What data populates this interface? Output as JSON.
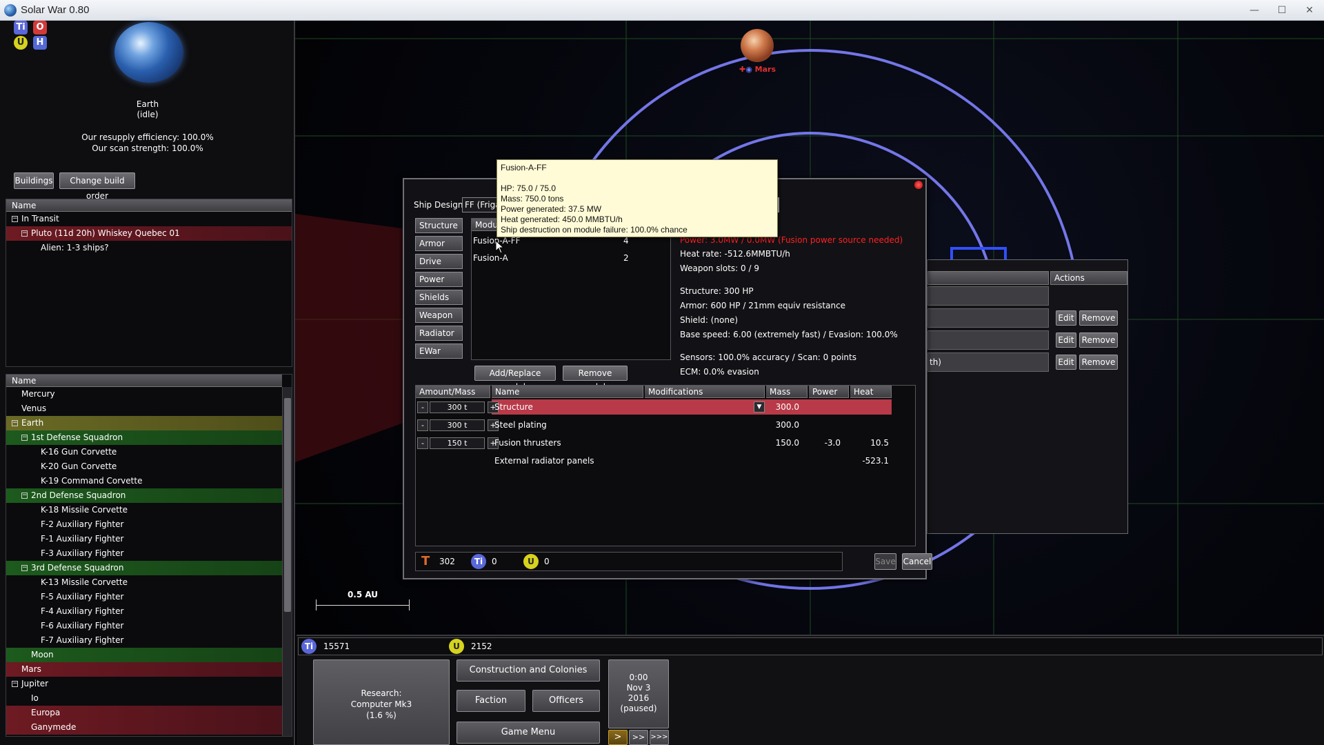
{
  "window": {
    "title": "Solar War 0.80",
    "minimize": "—",
    "maximize": "☐",
    "close": "✕"
  },
  "left": {
    "res_icons": [
      {
        "label": "Ti",
        "color": "#5a67d8"
      },
      {
        "label": "O",
        "color": "#d23a3a"
      },
      {
        "label": "U",
        "color": "#d6d21f"
      },
      {
        "label": "H",
        "color": "#5468d6"
      }
    ],
    "planet_name": "Earth",
    "planet_status": "(idle)",
    "resupply": "Our resupply efficiency: 100.0%",
    "scan": "Our scan strength: 100.0%",
    "buttons": {
      "buildings": "Buildings",
      "build_order": "Change build order"
    },
    "transit": {
      "header": "Name",
      "rows": [
        {
          "label": "In Transit",
          "level": 0,
          "toggle": "−",
          "style": ""
        },
        {
          "label": "Pluto (11d 20h) Whiskey Quebec 01",
          "level": 1,
          "toggle": "−",
          "style": "red"
        },
        {
          "label": "Alien: 1-3 ships?",
          "level": 2,
          "toggle": "",
          "style": ""
        }
      ]
    },
    "systems": {
      "header": "Name",
      "rows": [
        {
          "label": "Mercury",
          "level": 0,
          "toggle": "",
          "style": ""
        },
        {
          "label": "Venus",
          "level": 0,
          "toggle": "",
          "style": ""
        },
        {
          "label": "Earth",
          "level": 0,
          "toggle": "−",
          "style": "olive"
        },
        {
          "label": "1st Defense Squadron",
          "level": 1,
          "toggle": "−",
          "style": "green"
        },
        {
          "label": "K-16 Gun Corvette",
          "level": 2,
          "toggle": "",
          "style": ""
        },
        {
          "label": "K-20 Gun Corvette",
          "level": 2,
          "toggle": "",
          "style": ""
        },
        {
          "label": "K-19 Command Corvette",
          "level": 2,
          "toggle": "",
          "style": ""
        },
        {
          "label": "2nd Defense Squadron",
          "level": 1,
          "toggle": "−",
          "style": "green"
        },
        {
          "label": "K-18 Missile Corvette",
          "level": 2,
          "toggle": "",
          "style": ""
        },
        {
          "label": "F-2 Auxiliary Fighter",
          "level": 2,
          "toggle": "",
          "style": ""
        },
        {
          "label": "F-1 Auxiliary Fighter",
          "level": 2,
          "toggle": "",
          "style": ""
        },
        {
          "label": "F-3 Auxiliary Fighter",
          "level": 2,
          "toggle": "",
          "style": ""
        },
        {
          "label": "3rd Defense Squadron",
          "level": 1,
          "toggle": "−",
          "style": "green"
        },
        {
          "label": "K-13 Missile Corvette",
          "level": 2,
          "toggle": "",
          "style": ""
        },
        {
          "label": "F-5 Auxiliary Fighter",
          "level": 2,
          "toggle": "",
          "style": ""
        },
        {
          "label": "F-4 Auxiliary Fighter",
          "level": 2,
          "toggle": "",
          "style": ""
        },
        {
          "label": "F-6 Auxiliary Fighter",
          "level": 2,
          "toggle": "",
          "style": ""
        },
        {
          "label": "F-7 Auxiliary Fighter",
          "level": 2,
          "toggle": "",
          "style": ""
        },
        {
          "label": "Moon",
          "level": 1,
          "toggle": "",
          "style": "green"
        },
        {
          "label": "Mars",
          "level": 0,
          "toggle": "",
          "style": "red"
        },
        {
          "label": "Jupiter",
          "level": 0,
          "toggle": "−",
          "style": ""
        },
        {
          "label": "Io",
          "level": 1,
          "toggle": "",
          "style": ""
        },
        {
          "label": "Europa",
          "level": 1,
          "toggle": "",
          "style": "red"
        },
        {
          "label": "Ganymede",
          "level": 1,
          "toggle": "",
          "style": "red"
        }
      ]
    }
  },
  "map": {
    "mars_label": "Mars",
    "scale_label": "0.5 AU"
  },
  "fleet_panel": {
    "actions_header": "Actions",
    "partial_text": "th)",
    "rows": [
      {
        "edit": "Edit",
        "remove": "Remove"
      },
      {
        "edit": "Edit",
        "remove": "Remove"
      },
      {
        "edit": "Edit",
        "remove": "Remove"
      }
    ]
  },
  "dialog": {
    "ship_design_label": "Ship Design",
    "design_value": "FF (Friga",
    "categories": [
      "Structure",
      "Armor",
      "Drive",
      "Power",
      "Shields",
      "Weapon",
      "Radiator",
      "EWar"
    ],
    "module_header": "Modu",
    "modules": [
      {
        "name": "Fusion-A-FF",
        "count": "4"
      },
      {
        "name": "Fusion-A",
        "count": "2"
      }
    ],
    "power_warning": "Power: 3.0MW / 0.0MW (Fusion power source needed)",
    "stats1": [
      "Heat rate: -512.6MMBTU/h",
      "Weapon slots: 0 / 9"
    ],
    "stats2": [
      "Structure: 300 HP",
      "Armor: 600 HP / 21mm equiv resistance",
      "Shield: (none)",
      "Base speed: 6.00 (extremely fast) / Evasion: 100.0%"
    ],
    "stats3": [
      "Sensors: 100.0% accuracy / Scan: 0 points",
      "ECM: 0.0% evasion"
    ],
    "add_replace": "Add/Replace module",
    "remove_module": "Remove module",
    "columns": [
      "Amount/Mass",
      "Name",
      "Modifications",
      "Mass",
      "Power",
      "Heat"
    ],
    "components": [
      {
        "minus": "-",
        "amount": "300 t",
        "plus": "+",
        "name": "Structure",
        "mass": "300.0",
        "power": "",
        "heat": "",
        "selected": true,
        "stepper": true
      },
      {
        "minus": "-",
        "amount": "300 t",
        "plus": "+",
        "name": "Steel plating",
        "mass": "300.0",
        "power": "",
        "heat": "",
        "selected": false,
        "stepper": true
      },
      {
        "minus": "-",
        "amount": "150 t",
        "plus": "+",
        "name": "Fusion thrusters",
        "mass": "150.0",
        "power": "-3.0",
        "heat": "10.5",
        "selected": false,
        "stepper": true
      },
      {
        "minus": "",
        "amount": "",
        "plus": "",
        "name": "External radiator panels",
        "mass": "",
        "power": "",
        "heat": "-523.1",
        "selected": false,
        "stepper": false
      }
    ],
    "costs": [
      {
        "icon": "T",
        "value": "302",
        "color": "#e06a2a"
      },
      {
        "icon": "Ti",
        "value": "0",
        "color": "#5a67d8"
      },
      {
        "icon": "U",
        "value": "0",
        "color": "#d6d21f"
      }
    ],
    "save": "Save",
    "cancel": "Cancel"
  },
  "tooltip": {
    "title": "Fusion-A-FF",
    "lines": [
      "HP: 75.0 / 75.0",
      "Mass: 750.0 tons",
      "Power generated: 37.5 MW",
      "Heat generated: 450.0 MMBTU/h",
      "Ship destruction on module failure: 100.0% chance"
    ]
  },
  "bottom": {
    "ti_label": "Ti",
    "ti_amount": "15571",
    "u_label": "U",
    "u_amount": "2152",
    "research": [
      "Research:",
      "Computer Mk3",
      "(1.6 %)"
    ],
    "construction": "Construction and Colonies",
    "faction": "Faction",
    "officers": "Officers",
    "game_menu": "Game Menu",
    "clock": [
      "0:00",
      "Nov 3",
      "2016",
      "(paused)"
    ],
    "speeds": [
      ">",
      ">>",
      ">>>"
    ]
  }
}
